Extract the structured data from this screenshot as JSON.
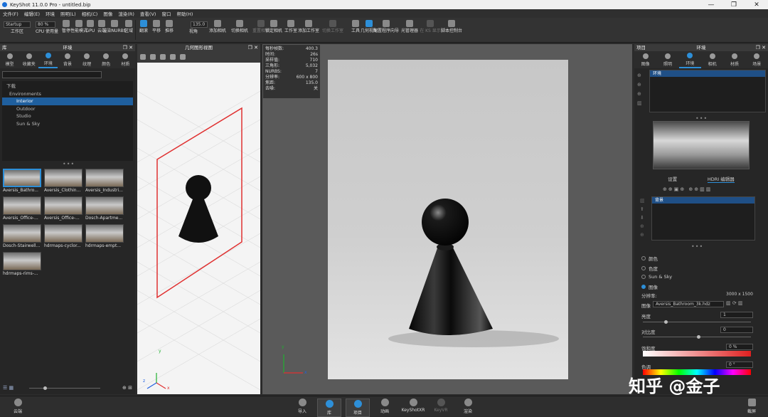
{
  "titlebar": {
    "title": "KeyShot 11.0.0 Pro - untitled.bip",
    "min": "—",
    "max": "❐",
    "close": "✕"
  },
  "menu": [
    "文件(F)",
    "编辑(E)",
    "环境",
    "照明(L)",
    "相机(C)",
    "图像",
    "渲染(R)",
    "查看(V)",
    "窗口",
    "帮助(H)"
  ],
  "toolbar": {
    "workspace_combo": "Startup",
    "cpu_combo": "80 %",
    "fov_value": "135.0",
    "buttons": [
      "工作区",
      "CPU 使用量",
      "暂停",
      "性能模式",
      "GPU",
      "云端",
      "渲染NURBS",
      "区域",
      "翻滚",
      "平移",
      "推移",
      "视角",
      "添加相机",
      "切换相机",
      "重置相机",
      "锁定相机",
      "工作室",
      "添加工作室",
      "切换工作室",
      "工具",
      "几何视图",
      "配置程序向导",
      "光管理器",
      "在 KS 显示",
      "脚本控制台"
    ]
  },
  "left_panel": {
    "title": "库",
    "env_title": "环境",
    "tabs": [
      "模型",
      "收藏夹",
      "环境",
      "背景",
      "纹理",
      "颜色",
      "材质"
    ],
    "tree": [
      "下载",
      "Environments",
      "Interior",
      "Outdoor",
      "Studio",
      "Sun & Sky"
    ],
    "thumbs": [
      "Aversis_Bathro...",
      "Aversis_Clothin...",
      "Aversis_Industri...",
      "Aversis_Office-...",
      "Aversis_Office-...",
      "Dosch-Apartme...",
      "Dosch-Stairwell...",
      "hdrmaps-cyclor...",
      "hdrmaps-empt...",
      "hdrmaps-rims-..."
    ]
  },
  "geo_view": {
    "title": "几何图形视图",
    "axes": {
      "y": "y",
      "x": "x",
      "z": "z"
    }
  },
  "stats": {
    "rows": [
      [
        "每秒帧数:",
        "400.3"
      ],
      [
        "时间:",
        "26s"
      ],
      [
        "采样值:",
        "710"
      ],
      [
        "三角形:",
        "5,032"
      ],
      [
        "NURBS:",
        "7"
      ],
      [
        "分辨率:",
        "600 x 800"
      ],
      [
        "焦距:",
        "135.0"
      ],
      [
        "去噪:",
        "关"
      ]
    ]
  },
  "right_panel": {
    "title": "项目",
    "env_title": "环境",
    "tabs": [
      "图像",
      "照明",
      "环境",
      "相机",
      "材质",
      "场景"
    ],
    "env_item": "环境",
    "subtabs": [
      "设置",
      "HDRI 编辑器"
    ],
    "bg_item": "背景",
    "radios": [
      "颜色",
      "色度",
      "Sun & Sky",
      "图像"
    ],
    "resolution_label": "分辨率:",
    "resolution_value": "3000 x 1500",
    "image_label": "图像",
    "image_value": "Aversis_Bathroom_3k.hdz",
    "brightness_label": "亮度",
    "brightness_value": "1",
    "contrast_label": "对比度",
    "contrast_value": "0",
    "saturation_label": "饱和度",
    "saturation_value": "0 %",
    "hue_label": "色调",
    "hue_value": "0 °"
  },
  "bottombar": {
    "cloud": "云端",
    "import": "导入",
    "library": "库",
    "project": "项目",
    "animation": "动画",
    "keyshotxr": "KeyShotXR",
    "keyvr": "KeyVR",
    "render": "渲染",
    "screenshot": "截屏"
  },
  "watermark": "知乎 @金子",
  "colors": {
    "accent": "#2d8fd8",
    "selection_red": "#e03030"
  }
}
